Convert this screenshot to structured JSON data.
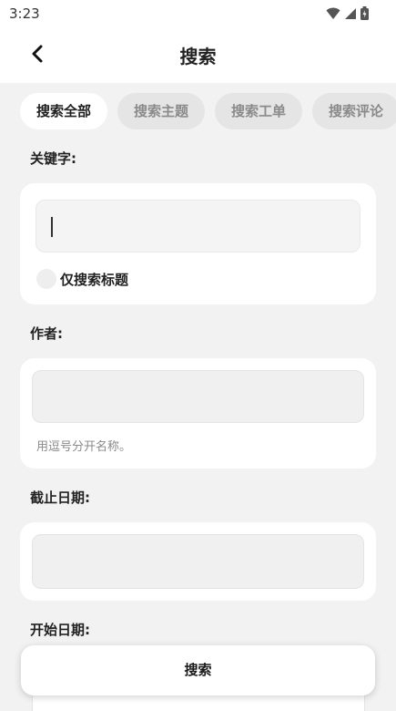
{
  "status": {
    "time": "3:23",
    "icons": [
      "wifi-icon",
      "signal-icon",
      "battery-icon"
    ]
  },
  "appbar": {
    "title": "搜索",
    "back_icon": "chevron-left-icon"
  },
  "tabs": [
    {
      "label": "搜索全部",
      "active": true
    },
    {
      "label": "搜索主题",
      "active": false
    },
    {
      "label": "搜索工单",
      "active": false
    },
    {
      "label": "搜索评论",
      "active": false
    }
  ],
  "keyword": {
    "label": "关键字:",
    "value": "",
    "checkbox_label": "仅搜索标题",
    "checked": false
  },
  "author": {
    "label": "作者:",
    "value": "",
    "hint": "用逗号分开名称。"
  },
  "end_date": {
    "label": "截止日期:",
    "value": ""
  },
  "start_date": {
    "label": "开始日期:"
  },
  "search_button": {
    "label": "搜索"
  },
  "colors": {
    "background": "#f2f2f2",
    "card": "#ffffff",
    "tab_inactive": "#e5e5e5",
    "text": "#1a1a1a",
    "hint": "#8a8a8a"
  }
}
